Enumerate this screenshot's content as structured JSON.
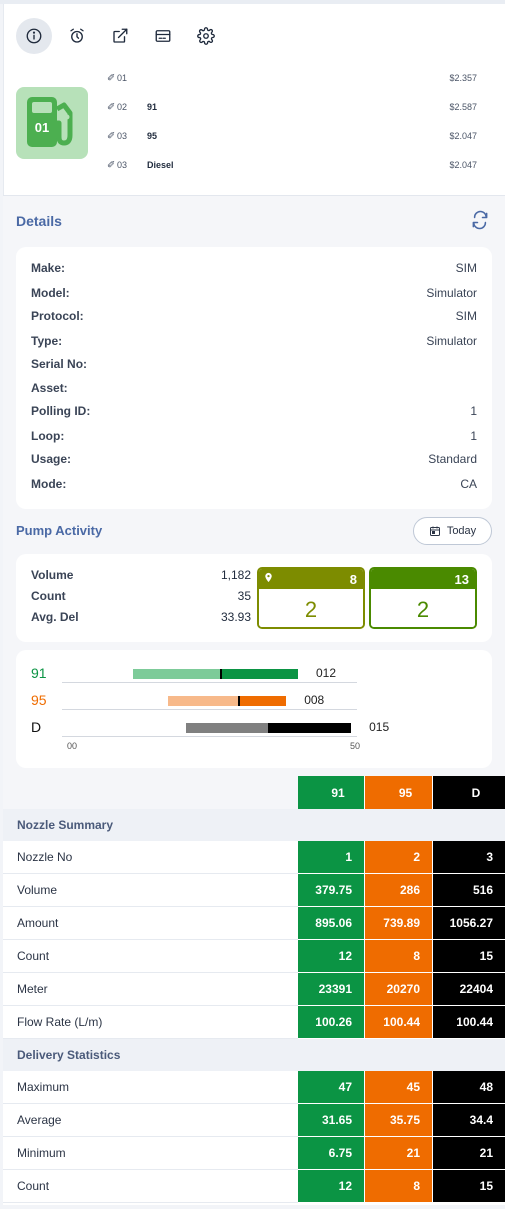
{
  "toolbar": {
    "icons": [
      "info-icon",
      "alarm-icon",
      "external-link-icon",
      "card-icon",
      "settings-icon"
    ]
  },
  "pump": {
    "icon_label": "01",
    "nozzles": [
      {
        "no": "01",
        "grade": "",
        "price": "$2.357"
      },
      {
        "no": "02",
        "grade": "91",
        "price": "$2.587"
      },
      {
        "no": "03",
        "grade": "95",
        "price": "$2.047"
      },
      {
        "no": "03",
        "grade": "Diesel",
        "price": "$2.047"
      }
    ]
  },
  "details": {
    "title": "Details",
    "rows": [
      {
        "key": "Make:",
        "value": "SIM"
      },
      {
        "key": "Model:",
        "value": "Simulator"
      },
      {
        "key": "Protocol:",
        "value": "SIM"
      },
      {
        "key": "Type:",
        "value": "Simulator"
      },
      {
        "key": "Serial No:",
        "value": ""
      },
      {
        "key": "Asset:",
        "value": ""
      },
      {
        "key": "Polling ID:",
        "value": "1"
      },
      {
        "key": "Loop:",
        "value": "1"
      },
      {
        "key": "Usage:",
        "value": "Standard"
      },
      {
        "key": "Mode:",
        "value": "CA"
      }
    ]
  },
  "activity": {
    "title": "Pump Activity",
    "date_button": "Today",
    "stats": [
      {
        "key": "Volume",
        "value": "1,182"
      },
      {
        "key": "Count",
        "value": "35"
      },
      {
        "key": "Avg. Del",
        "value": "33.93"
      }
    ],
    "boxes": [
      {
        "header": "8",
        "value": "2",
        "color": "#7d8c00",
        "pin": true
      },
      {
        "header": "13",
        "value": "2",
        "color": "#4a8a00",
        "pin": false
      }
    ]
  },
  "chart_data": {
    "type": "bar",
    "categories": [
      "91",
      "95",
      "D"
    ],
    "value_labels": [
      "012",
      "008",
      "015"
    ],
    "ranges": [
      {
        "light_start": 12,
        "mid": 27,
        "end": 40,
        "colors": [
          "#7dcb99",
          "#0b9444"
        ]
      },
      {
        "light_start": 18,
        "mid": 30,
        "end": 38,
        "colors": [
          "#f7b98a",
          "#ef6c00"
        ]
      },
      {
        "light_start": 21,
        "mid": 35,
        "end": 49,
        "colors": [
          "#808080",
          "#000000"
        ]
      }
    ],
    "label_colors": [
      "#0b9444",
      "#ef6c00",
      "#111111"
    ],
    "xlim": [
      0,
      50
    ],
    "tick_labels": [
      "00",
      "50"
    ]
  },
  "table": {
    "columns": [
      "91",
      "95",
      "D"
    ],
    "nozzle_summary_title": "Nozzle Summary",
    "nozzle_rows": [
      {
        "label": "Nozzle No",
        "values": [
          "1",
          "2",
          "3"
        ]
      },
      {
        "label": "Volume",
        "values": [
          "379.75",
          "286",
          "516"
        ]
      },
      {
        "label": "Amount",
        "values": [
          "895.06",
          "739.89",
          "1056.27"
        ]
      },
      {
        "label": "Count",
        "values": [
          "12",
          "8",
          "15"
        ]
      },
      {
        "label": "Meter",
        "values": [
          "23391",
          "20270",
          "22404"
        ]
      },
      {
        "label": "Flow Rate (L/m)",
        "values": [
          "100.26",
          "100.44",
          "100.44"
        ]
      }
    ],
    "delivery_title": "Delivery Statistics",
    "delivery_rows": [
      {
        "label": "Maximum",
        "values": [
          "47",
          "45",
          "48"
        ]
      },
      {
        "label": "Average",
        "values": [
          "31.65",
          "35.75",
          "34.4"
        ]
      },
      {
        "label": "Minimum",
        "values": [
          "6.75",
          "21",
          "21"
        ]
      },
      {
        "label": "Count",
        "values": [
          "12",
          "8",
          "15"
        ]
      }
    ]
  }
}
